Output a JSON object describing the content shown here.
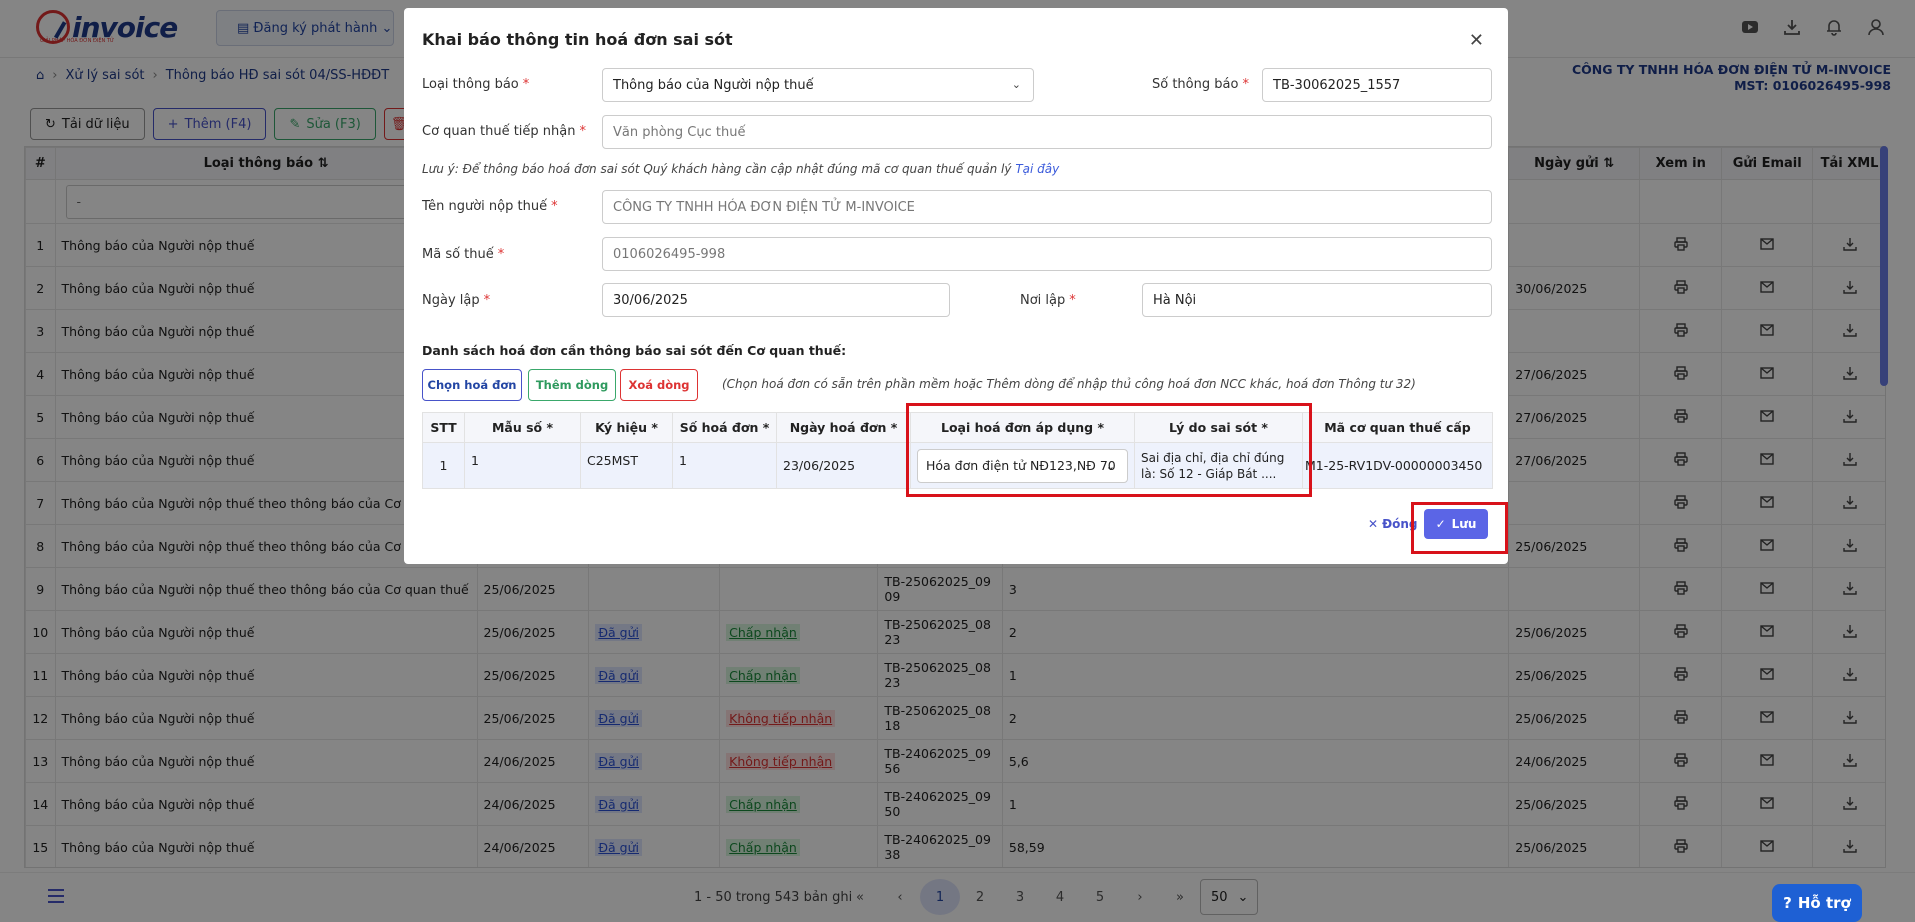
{
  "app": {
    "logo_text": "invoice",
    "logo_tagline": "GIẢI PHÁP HÓA ĐƠN ĐIỆN TỬ",
    "register_label": "Đăng ký phát hành",
    "top_icons": [
      "youtube-icon",
      "download-icon",
      "bell-icon",
      "user-icon"
    ]
  },
  "breadcrumb": {
    "items": [
      "Xử lý sai sót",
      "Thông báo HĐ sai sót 04/SS-HĐĐT"
    ]
  },
  "company": {
    "name": "CÔNG TY TNHH HÓA ĐƠN ĐIỆN TỬ M-INVOICE",
    "tax": "MST: 0106026495-998"
  },
  "toolbar": {
    "reload_label": "Tải dữ liệu",
    "add_label": "Thêm (F4)",
    "edit_label": "Sửa (F3)"
  },
  "grid": {
    "headers": {
      "num": "#",
      "type": "Loại thông báo",
      "send_date": "Ngày gửi",
      "print": "Xem in",
      "email": "Gửi Email",
      "xml": "Tải XML"
    },
    "filter_placeholder": "-",
    "rows": [
      {
        "n": "1",
        "type": "Thông báo của Người nộp thuế",
        "date": "",
        "sent": "",
        "status": "",
        "code": "",
        "qty": "",
        "send_date": ""
      },
      {
        "n": "2",
        "type": "Thông báo của Người nộp thuế",
        "date": "",
        "sent": "",
        "status": "",
        "code": "",
        "qty": "",
        "send_date": "30/06/2025"
      },
      {
        "n": "3",
        "type": "Thông báo của Người nộp thuế",
        "date": "",
        "sent": "",
        "status": "",
        "code": "",
        "qty": "",
        "send_date": ""
      },
      {
        "n": "4",
        "type": "Thông báo của Người nộp thuế",
        "date": "",
        "sent": "",
        "status": "",
        "code": "",
        "qty": "",
        "send_date": "27/06/2025"
      },
      {
        "n": "5",
        "type": "Thông báo của Người nộp thuế",
        "date": "",
        "sent": "",
        "status": "",
        "code": "",
        "qty": "",
        "send_date": "27/06/2025"
      },
      {
        "n": "6",
        "type": "Thông báo của Người nộp thuế",
        "date": "",
        "sent": "",
        "status": "",
        "code": "",
        "qty": "",
        "send_date": "27/06/2025"
      },
      {
        "n": "7",
        "type": "Thông báo của Người nộp thuế theo thông báo của Cơ quan",
        "date": "",
        "sent": "",
        "status": "",
        "code": "",
        "qty": "",
        "send_date": ""
      },
      {
        "n": "8",
        "type": "Thông báo của Người nộp thuế theo thông báo của Cơ qua",
        "date": "",
        "sent": "",
        "status": "",
        "code": "",
        "qty": "",
        "send_date": "25/06/2025"
      },
      {
        "n": "9",
        "type": "Thông báo của Người nộp thuế theo thông báo của Cơ quan thuế",
        "date": "25/06/2025",
        "sent": "",
        "status": "",
        "status_kind": "",
        "code": "TB-25062025_0909",
        "qty": "3",
        "send_date": ""
      },
      {
        "n": "10",
        "type": "Thông báo của Người nộp thuế",
        "date": "25/06/2025",
        "sent": "Đã gửi",
        "status": "Chấp nhận",
        "status_kind": "green",
        "code": "TB-25062025_0823",
        "qty": "2",
        "send_date": "25/06/2025"
      },
      {
        "n": "11",
        "type": "Thông báo của Người nộp thuế",
        "date": "25/06/2025",
        "sent": "Đã gửi",
        "status": "Chấp nhận",
        "status_kind": "green",
        "code": "TB-25062025_0823",
        "qty": "1",
        "send_date": "25/06/2025"
      },
      {
        "n": "12",
        "type": "Thông báo của Người nộp thuế",
        "date": "25/06/2025",
        "sent": "Đã gửi",
        "status": "Không tiếp nhận",
        "status_kind": "red",
        "code": "TB-25062025_0818",
        "qty": "2",
        "send_date": "25/06/2025"
      },
      {
        "n": "13",
        "type": "Thông báo của Người nộp thuế",
        "date": "24/06/2025",
        "sent": "Đã gửi",
        "status": "Không tiếp nhận",
        "status_kind": "red",
        "code": "TB-24062025_0956",
        "qty": "5,6",
        "send_date": "24/06/2025"
      },
      {
        "n": "14",
        "type": "Thông báo của Người nộp thuế",
        "date": "24/06/2025",
        "sent": "Đã gửi",
        "status": "Chấp nhận",
        "status_kind": "green",
        "code": "TB-24062025_0950",
        "qty": "1",
        "send_date": "25/06/2025"
      },
      {
        "n": "15",
        "type": "Thông báo của Người nộp thuế",
        "date": "24/06/2025",
        "sent": "Đã gửi",
        "status": "Chấp nhận",
        "status_kind": "green",
        "code": "TB-24062025_0938",
        "qty": "58,59",
        "send_date": "25/06/2025"
      }
    ]
  },
  "pager": {
    "info": "1 - 50 trong 543 bản ghi",
    "pages": [
      "1",
      "2",
      "3",
      "4",
      "5"
    ],
    "active_page": "1",
    "page_size": "50",
    "help_label": "Hỗ trợ"
  },
  "modal": {
    "title": "Khai báo thông tin hoá đơn sai sót",
    "notice_type_label": "Loại thông báo",
    "notice_type_value": "Thông báo của Người nộp thuế",
    "notice_no_label": "Số thông báo",
    "notice_no_value": "TB-30062025_1557",
    "tax_office_label": "Cơ quan thuế tiếp nhận",
    "tax_office_placeholder": "Văn phòng Cục thuế",
    "note_text": "Lưu ý: Để thông báo hoá đơn sai sót Quý khách hàng cần cập nhật đúng mã cơ quan thuế quản lý",
    "note_link": "Tại đây",
    "taxpayer_label": "Tên người nộp thuế",
    "taxpayer_value": "CÔNG TY TNHH HÓA ĐƠN ĐIỆN TỬ M-INVOICE",
    "tax_code_label": "Mã số thuế",
    "tax_code_value": "0106026495-998",
    "date_label": "Ngày lập",
    "date_value": "30/06/2025",
    "place_label": "Nơi lập",
    "place_value": "Hà Nội",
    "section_title": "Danh sách hoá đơn cần thông báo sai sót đến Cơ quan thuế:",
    "choose_btn": "Chọn hoá đơn",
    "add_row_btn": "Thêm dòng",
    "delete_row_btn": "Xoá dòng",
    "hint": "(Chọn hoá đơn có sẵn trên phần mềm hoặc Thêm dòng để nhập thủ công hoá đơn NCC khác, hoá đơn Thông tư 32)",
    "table_headers": [
      "STT",
      "Mẫu số *",
      "Ký hiệu *",
      "Số hoá đơn *",
      "Ngày hoá đơn *",
      "Loại hoá đơn áp dụng *",
      "Lý do sai sót *",
      "Mã cơ quan thuế cấp"
    ],
    "row": {
      "stt": "1",
      "form": "1",
      "symbol": "C25MST",
      "number": "1",
      "date": "23/06/2025",
      "invoice_type": "Hóa đơn điện tử NĐ123,NĐ 70",
      "reason": "Sai địa chỉ, địa chỉ đúng là: Số 12 - Giáp Bát ....",
      "tax_code": "M1-25-RV1DV-00000003450"
    },
    "close_label": "Đóng",
    "save_label": "Lưu"
  },
  "colors": {
    "primary": "#4853c9",
    "highlight": "#d8121a",
    "success": "#3aa86b",
    "danger": "#dd3333"
  }
}
